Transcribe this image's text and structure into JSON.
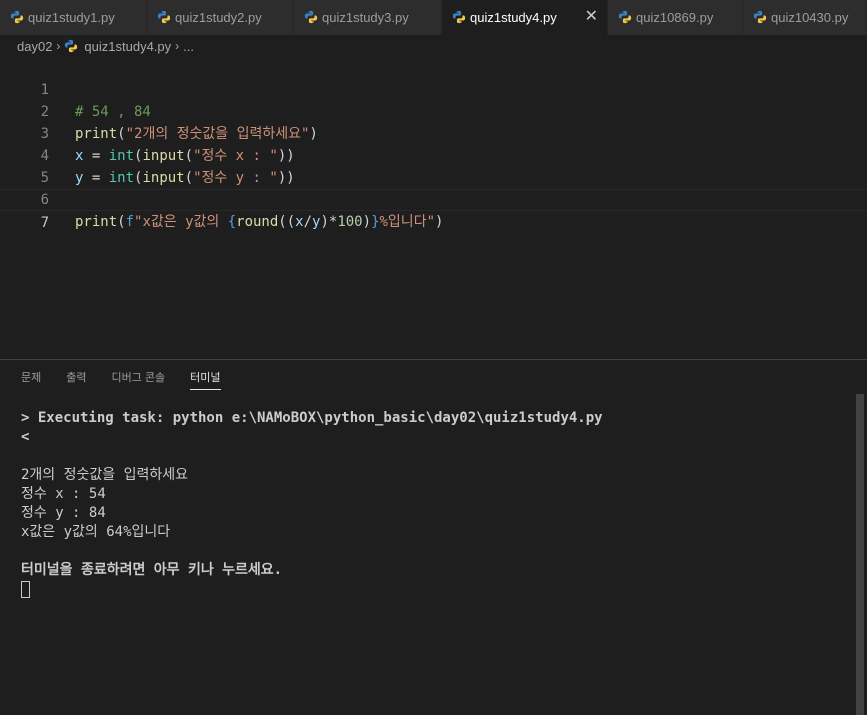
{
  "tabs": [
    {
      "label": "quiz1study1.py",
      "active": false
    },
    {
      "label": "quiz1study2.py",
      "active": false
    },
    {
      "label": "quiz1study3.py",
      "active": false
    },
    {
      "label": "quiz1study4.py",
      "active": true
    },
    {
      "label": "quiz10869.py",
      "active": false
    },
    {
      "label": "quiz10430.py",
      "active": false
    }
  ],
  "tab_close_glyph": "✕",
  "breadcrumb": {
    "folder": "day02",
    "file": "quiz1study4.py",
    "trail": "..."
  },
  "editor": {
    "line_numbers": [
      "1",
      "2",
      "3",
      "4",
      "5",
      "6",
      "7"
    ],
    "current_line": "7",
    "lines": {
      "l1": {
        "comment": "# 54 , 84"
      },
      "l2": {
        "fn": "print",
        "open": "(",
        "str": "\"2개의 정숫값을 입력하세요\"",
        "close": ")"
      },
      "l3": {
        "var": "x",
        "eq": " = ",
        "type": "int",
        "p1": "(",
        "fn": "input",
        "p2": "(",
        "str": "\"정수 x : \"",
        "p3": "))"
      },
      "l4": {
        "var": "y",
        "eq": " = ",
        "type": "int",
        "p1": "(",
        "fn": "input",
        "p2": "(",
        "str": "\"정수 y : \"",
        "p3": "))"
      },
      "l6": {
        "fn": "print",
        "open": "(",
        "prefix": "f",
        "str1": "\"x값은 y값의 ",
        "brace_open": "{",
        "round": "round",
        "rp1": "((",
        "x": "x",
        "slash": "/",
        "y": "y",
        "rp2": ")*",
        "hundred": "100",
        "rp3": ")",
        "brace_close": "}",
        "str2": "%입니다\"",
        "close": ")"
      }
    }
  },
  "panel": {
    "tabs": [
      {
        "label": "문제",
        "active": false
      },
      {
        "label": "출력",
        "active": false
      },
      {
        "label": "디버그 콘솔",
        "active": false
      },
      {
        "label": "터미널",
        "active": true
      }
    ],
    "terminal_lines": [
      "> Executing task: python e:\\NAMoBOX\\python_basic\\day02\\quiz1study4.py",
      "<",
      "",
      "2개의 정숫값을 입력하세요",
      "정수 x : 54",
      "정수 y : 84",
      "x값은 y값의 64%입니다",
      "",
      "터미널을 종료하려면 아무 키나 누르세요."
    ]
  },
  "colors": {
    "background": "#1e1e1e",
    "tab_bar": "#252526",
    "comment": "#6a9955",
    "function": "#dcdcaa",
    "string": "#ce9178",
    "variable": "#9cdcfe",
    "type": "#4ec9b0",
    "number": "#b5cea8"
  }
}
